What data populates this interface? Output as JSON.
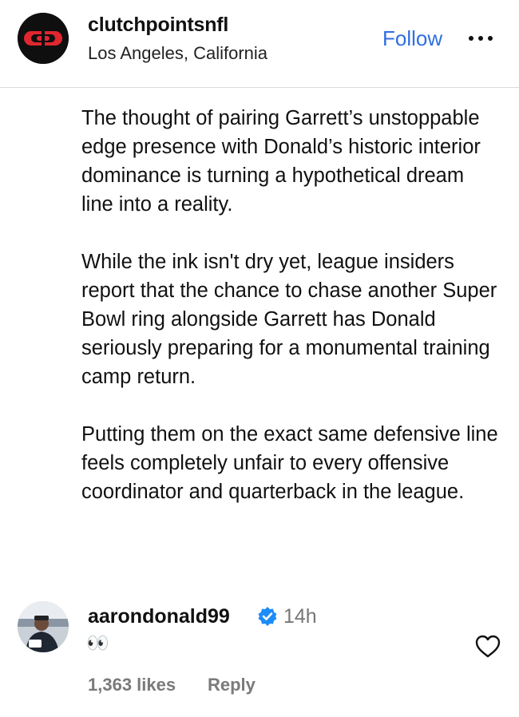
{
  "post": {
    "username": "clutchpointsnfl",
    "location": "Los Angeles, California",
    "follow_label": "Follow",
    "more_icon": "more-horizontal-icon",
    "logo_icon": "clutchpoints-logo-icon",
    "caption": [
      "The thought of pairing Garrett’s unstoppable edge presence with Donald’s historic interior dominance is turning a hypothetical dream line into a reality.",
      "While the ink isn't dry yet, league insiders report that the chance to chase another Super Bowl ring alongside Garrett has Donald seriously preparing for a monumental training camp return.",
      "Putting them on the exact same defensive line feels completely unfair to every offensive coordinator and quarterback in the league."
    ]
  },
  "comment": {
    "username": "aarondonald99",
    "verified_icon": "verified-badge-icon",
    "time": "14h",
    "text": "👀",
    "likes": "1,363 likes",
    "reply_label": "Reply",
    "heart_icon": "heart-outline-icon"
  },
  "colors": {
    "follow": "#2f6fe0",
    "verified": "#1d8cf8",
    "muted": "#7a7a7a",
    "logo_red": "#e0262e"
  }
}
